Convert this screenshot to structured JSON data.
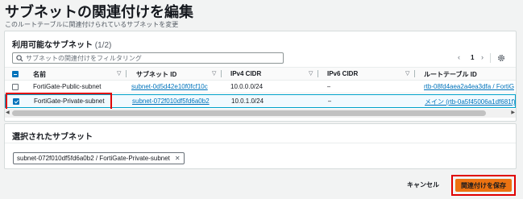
{
  "page": {
    "title": "サブネットの関連付けを編集",
    "subtitle": "このルートテーブルに関連付けられているサブネットを変更"
  },
  "available": {
    "heading": "利用可能なサブネット",
    "count": "(1/2)",
    "search_placeholder": "サブネットの関連付けをフィルタリング",
    "page_number": "1",
    "columns": [
      "名前",
      "サブネット ID",
      "IPv4 CIDR",
      "IPv6 CIDR",
      "ルートテーブル ID"
    ],
    "rows": [
      {
        "name": "FortiGate-Public-subnet",
        "subnet_id": "subnet-0d5d42e10f0fcf10c",
        "ipv4": "10.0.0.0/24",
        "ipv6": "–",
        "route_table": "rtb-08fd4aea2a4ea3dfa / FortiGa",
        "checked": false
      },
      {
        "name": "FortiGate-Private-subnet",
        "subnet_id": "subnet-072f010df5fd6a0b2",
        "ipv4": "10.0.1.0/24",
        "ipv6": "–",
        "route_table": "メイン (rtb-0a5f45006a1df681f)",
        "checked": true
      }
    ]
  },
  "selected": {
    "heading": "選択されたサブネット",
    "token": "subnet-072f010df5fd6a0b2 / FortiGate-Private-subnet"
  },
  "footer": {
    "cancel": "キャンセル",
    "save": "関連付けを保存"
  },
  "colors": {
    "accent": "#ec7211",
    "link": "#0073bb",
    "highlight": "#e00000"
  }
}
